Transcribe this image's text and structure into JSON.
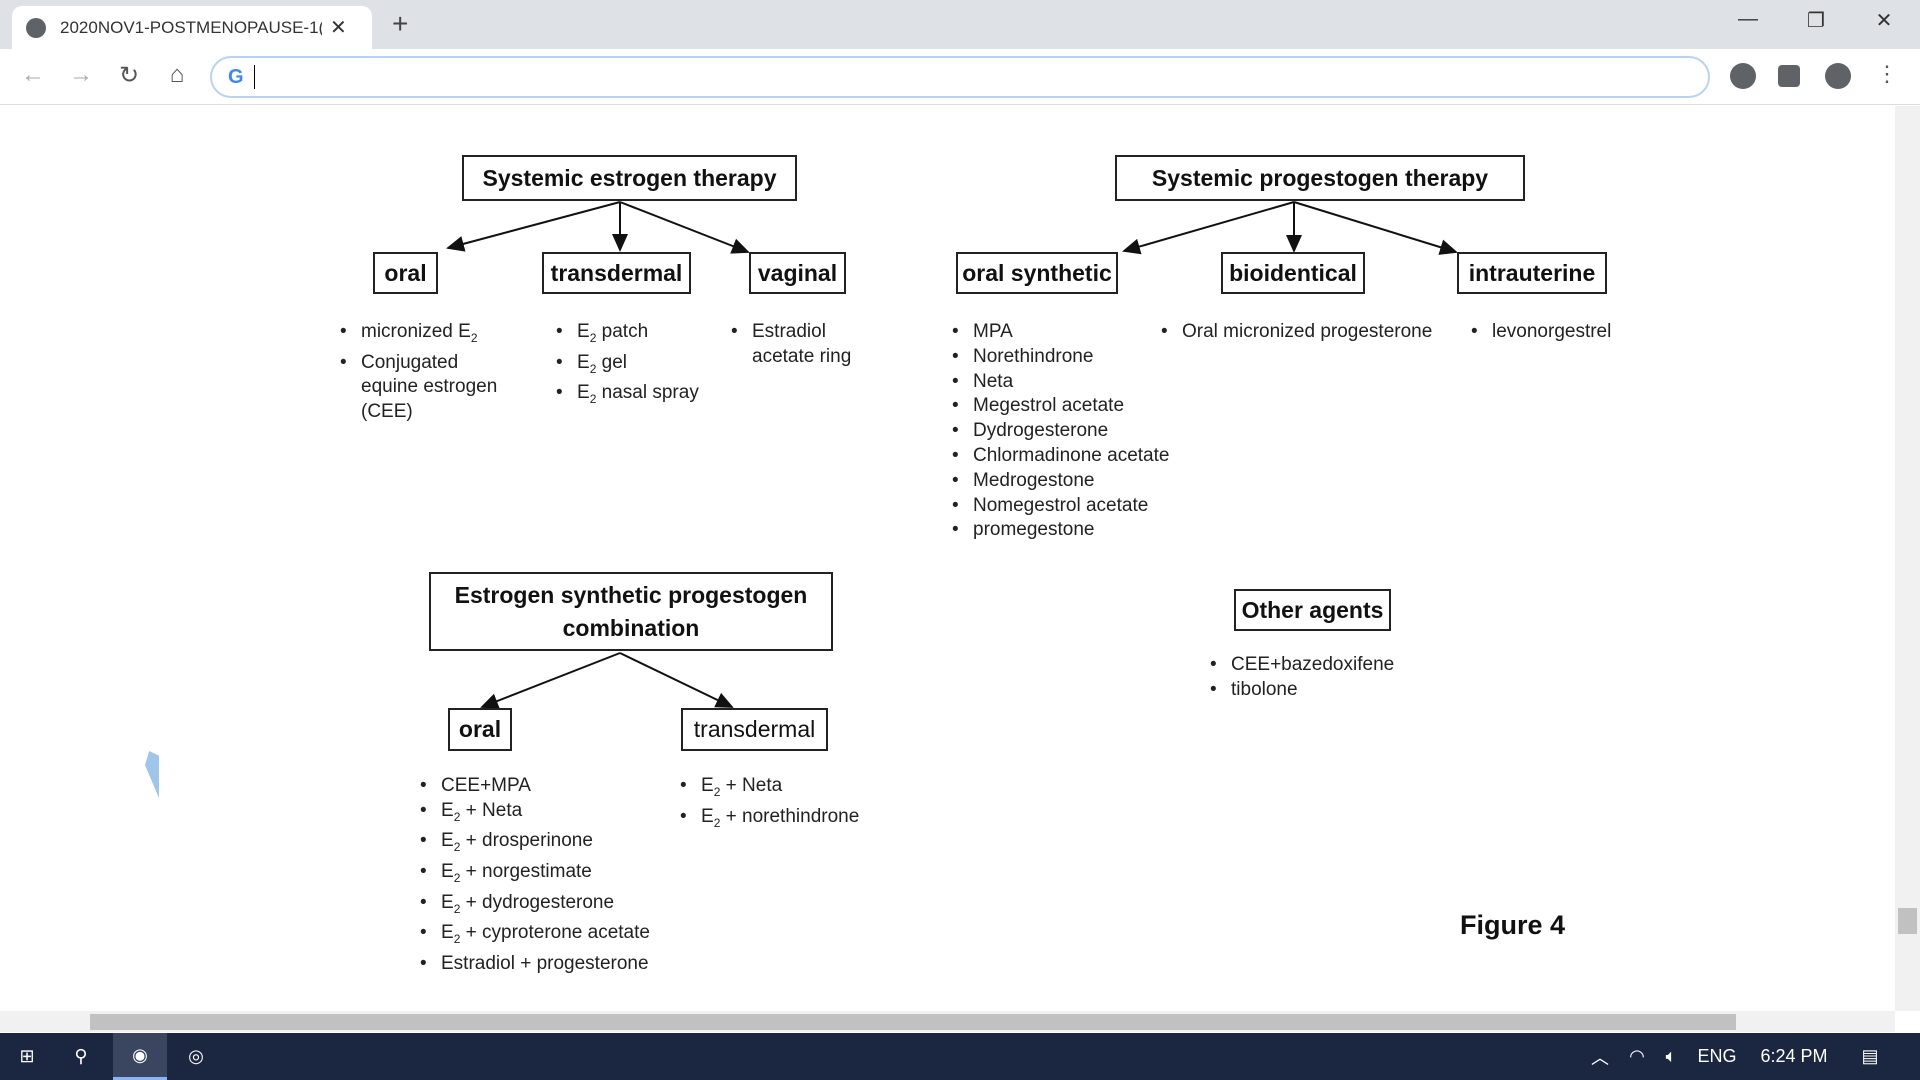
{
  "browser": {
    "tab_title": "2020NOV1-POSTMENOPAUSE-1(",
    "new_tab": "+",
    "close": "✕",
    "address": "",
    "minimize": "—",
    "restore": "❐",
    "close_window": "✕"
  },
  "figure": {
    "estrogen": {
      "title": "Systemic estrogen therapy",
      "oral": {
        "label": "oral",
        "items": [
          "micronized E|2",
          "Conjugated equine estrogen (CEE)"
        ]
      },
      "transdermal": {
        "label": "transdermal",
        "items": [
          "E|2| patch",
          "E|2| gel",
          "E|2| nasal spray"
        ]
      },
      "vaginal": {
        "label": "vaginal",
        "items": [
          "Estradiol acetate ring"
        ]
      }
    },
    "progestogen": {
      "title": "Systemic progestogen therapy",
      "oral_synthetic": {
        "label": "oral synthetic",
        "items": [
          "MPA",
          "Norethindrone",
          "Neta",
          "Megestrol acetate",
          "Dydrogesterone",
          "Chlormadinone acetate",
          "Medrogestone",
          "Nomegestrol acetate",
          "promegestone"
        ]
      },
      "bioidentical": {
        "label": "bioidentical",
        "items": [
          "Oral micronized progesterone"
        ]
      },
      "intrauterine": {
        "label": "intrauterine",
        "items": [
          "levonorgestrel"
        ]
      }
    },
    "combination": {
      "title": "Estrogen synthetic progestogen combination",
      "oral": {
        "label": "oral",
        "items": [
          "CEE+MPA",
          "E|2| + Neta",
          "E|2| + drosperinone",
          "E|2| + norgestimate",
          "E|2| + dydrogesterone",
          "E|2| + cyproterone acetate",
          "Estradiol + progesterone"
        ]
      },
      "transdermal": {
        "label": "transdermal",
        "items": [
          "E|2| + Neta",
          "E|2| + norethindrone"
        ]
      }
    },
    "other": {
      "title": "Other agents",
      "items": [
        "CEE+bazedoxifene",
        "tibolone"
      ]
    },
    "caption": "Figure 4"
  },
  "taskbar": {
    "language": "ENG",
    "time": "6:24 PM"
  }
}
